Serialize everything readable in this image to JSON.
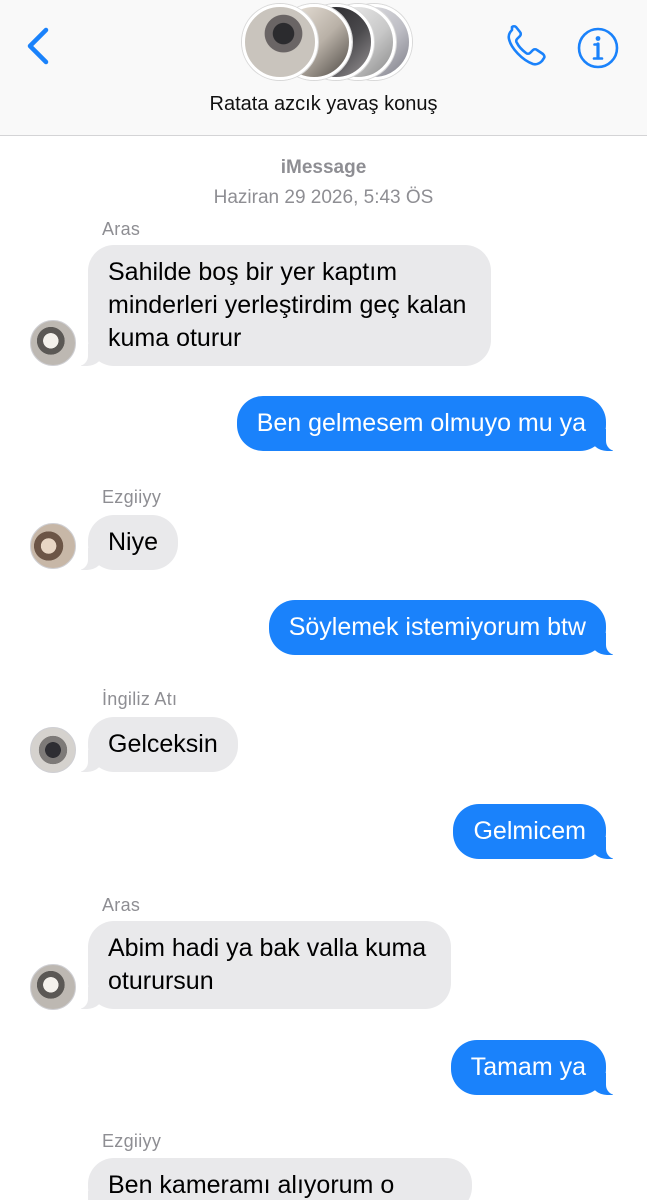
{
  "header": {
    "group_name": "Ratata azcık yavaş konuş",
    "icons": {
      "back": "chevron-left-icon",
      "call": "phone-icon",
      "info": "info-icon"
    },
    "accent_color": "#1a82fb"
  },
  "thread": {
    "service": "iMessage",
    "date": "Haziran 29 2026, 5:43 ÖS",
    "messages": [
      {
        "sender": "Aras",
        "text": "Sahilde boş bir yer kaptım\nminderleri yerleştirdim geç kalan\nkuma oturur",
        "direction": "incoming"
      },
      {
        "text": "Ben gelmesem olmuyo mu ya",
        "direction": "outgoing"
      },
      {
        "sender": "Ezgiiyy",
        "text": "Niye",
        "direction": "incoming"
      },
      {
        "text": "Söylemek istemiyorum btw",
        "direction": "outgoing"
      },
      {
        "sender": "İngiliz Atı",
        "text": "Gelceksin",
        "direction": "incoming"
      },
      {
        "text": "Gelmicem",
        "direction": "outgoing"
      },
      {
        "sender": "Aras",
        "text": "Abim hadi ya bak valla kuma\noturursun",
        "direction": "incoming"
      },
      {
        "text": "Tamam ya",
        "direction": "outgoing"
      },
      {
        "sender": "Ezgiiyy",
        "text": "Ben kameramı alıyorum o",
        "direction": "incoming"
      }
    ]
  },
  "colors": {
    "incoming_bubble": "#e9e9eb",
    "outgoing_bubble": "#1a82fb",
    "meta_text": "#8e8e93"
  }
}
